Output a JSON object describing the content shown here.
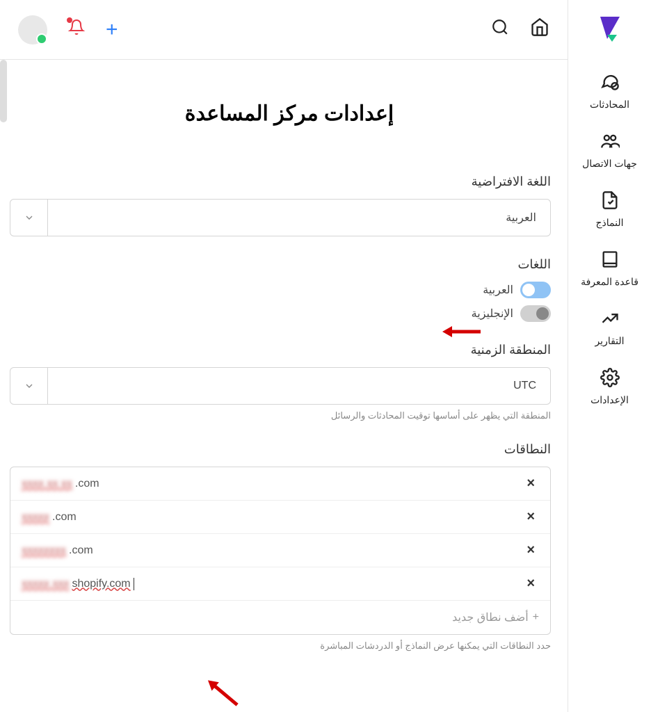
{
  "sidebar": {
    "items": [
      {
        "label": "المحادثات",
        "icon": "chat-icon"
      },
      {
        "label": "جهات الاتصال",
        "icon": "contacts-icon"
      },
      {
        "label": "النماذج",
        "icon": "forms-icon"
      },
      {
        "label": "قاعدة المعرفة",
        "icon": "knowledge-icon"
      },
      {
        "label": "التقارير",
        "icon": "reports-icon"
      },
      {
        "label": "الإعدادات",
        "icon": "settings-icon"
      }
    ]
  },
  "page": {
    "title": "إعدادات مركز المساعدة"
  },
  "fields": {
    "default_language": {
      "label": "اللغة الافتراضية",
      "value": "العربية"
    },
    "languages": {
      "label": "اللغات",
      "options": [
        {
          "label": "العربية",
          "on": true
        },
        {
          "label": "الإنجليزية",
          "on": false
        }
      ]
    },
    "timezone": {
      "label": "المنطقة الزمنية",
      "value": "UTC",
      "help": "المنطقة التي يظهر على أساسها توقيت المحادثات والرسائل"
    },
    "domains": {
      "label": "النطاقات",
      "rows": [
        {
          "blurred": "xxxx xx xx",
          "suffix": ".com"
        },
        {
          "blurred": "xxxxx",
          "suffix": ".com"
        },
        {
          "blurred": "xxxxxxxx",
          "suffix": ".com"
        },
        {
          "blurred": "xxxxx xxx",
          "suffix": "shopify.com"
        }
      ],
      "add_label": "أضف نطاق جديد",
      "help": "حدد النطاقات التي يمكنها عرض النماذج أو الدردشات المباشرة"
    }
  }
}
